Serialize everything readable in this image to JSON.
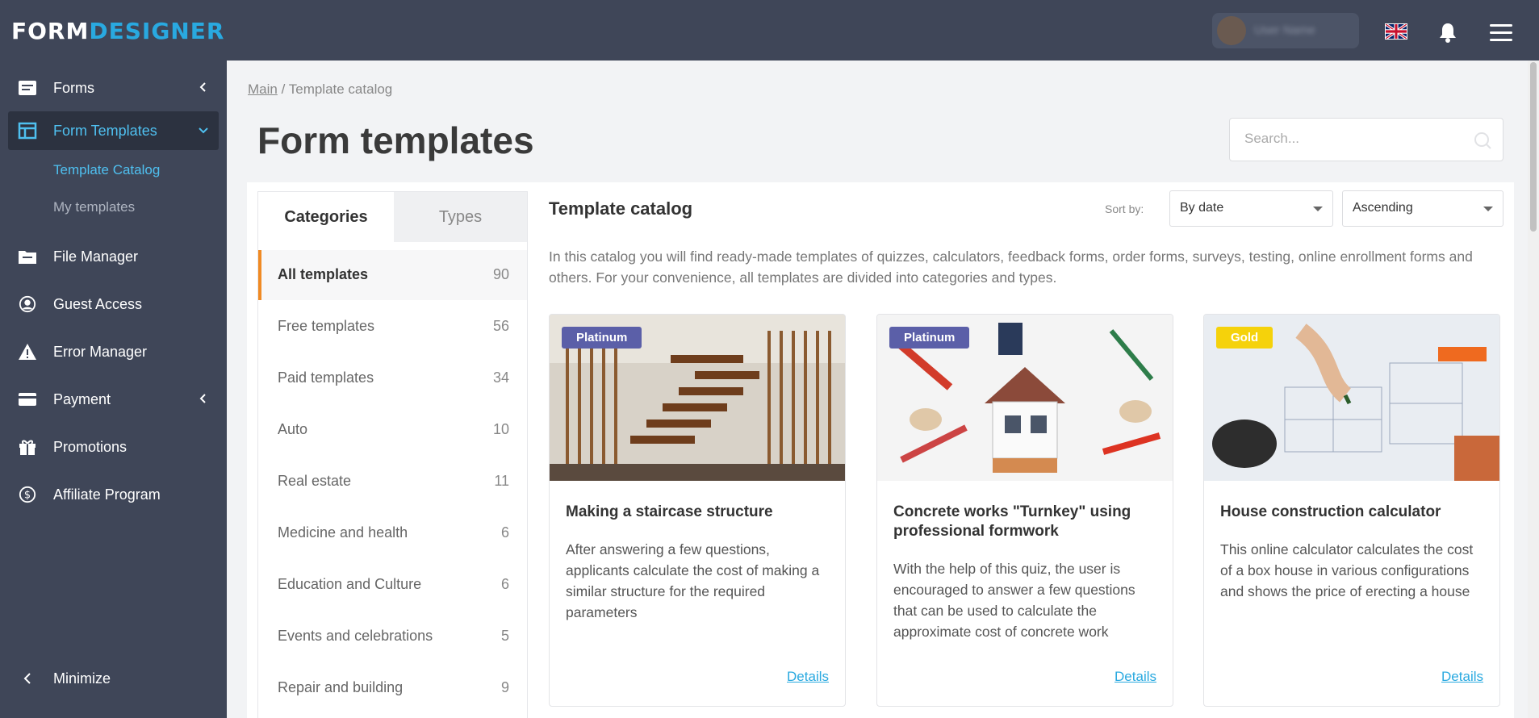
{
  "header": {
    "logo_part1": "FORM",
    "logo_part2": "DESIGNER",
    "user_name": "User Name"
  },
  "sidebar": {
    "items": [
      {
        "label": "Forms"
      },
      {
        "label": "Form Templates"
      },
      {
        "label": "File Manager"
      },
      {
        "label": "Guest Access"
      },
      {
        "label": "Error Manager"
      },
      {
        "label": "Payment"
      },
      {
        "label": "Promotions"
      },
      {
        "label": "Affiliate Program"
      }
    ],
    "subitems": [
      {
        "label": "Template Catalog"
      },
      {
        "label": "My templates"
      }
    ],
    "minimize_label": "Minimize"
  },
  "breadcrumb": {
    "main": "Main",
    "separator": " / ",
    "current": "Template catalog"
  },
  "page_title": "Form templates",
  "search": {
    "placeholder": "Search...",
    "value": ""
  },
  "tabs": {
    "categories": "Categories",
    "types": "Types"
  },
  "categories": [
    {
      "name": "All templates",
      "count": "90"
    },
    {
      "name": "Free templates",
      "count": "56"
    },
    {
      "name": "Paid templates",
      "count": "34"
    },
    {
      "name": "Auto",
      "count": "10"
    },
    {
      "name": "Real estate",
      "count": "11"
    },
    {
      "name": "Medicine and health",
      "count": "6"
    },
    {
      "name": "Education and Culture",
      "count": "6"
    },
    {
      "name": "Events and celebrations",
      "count": "5"
    },
    {
      "name": "Repair and building",
      "count": "9"
    }
  ],
  "catalog": {
    "title": "Template catalog",
    "sort_label": "Sort by:",
    "sort_by": "By date",
    "order": "Ascending",
    "description": "In this catalog you will find ready-made templates of quizzes, calculators, feedback forms, order forms, surveys, testing, online enrollment forms and others. For your convenience, all templates are divided into categories and types."
  },
  "cards": [
    {
      "badge": "Platinum",
      "title": "Making a staircase structure",
      "description": "After answering a few questions, applicants calculate the cost of making a similar structure for the required parameters",
      "link": "Details"
    },
    {
      "badge": "Platinum",
      "title": "Concrete works \"Turnkey\" using professional formwork",
      "description": "With the help of this quiz, the user is encouraged to answer a few questions that can be used to calculate the approximate cost of concrete work",
      "link": "Details"
    },
    {
      "badge": "Gold",
      "title": "House construction calculator",
      "description": "This online calculator calculates the cost of a box house in various configurations and shows the price of erecting a house",
      "link": "Details"
    }
  ],
  "colors": {
    "sidebar_bg": "#3f4658",
    "accent": "#29a9e0",
    "active_category_border": "#f08a24",
    "badge_platinum": "#5b5fa8",
    "badge_gold": "#f5d20b"
  }
}
